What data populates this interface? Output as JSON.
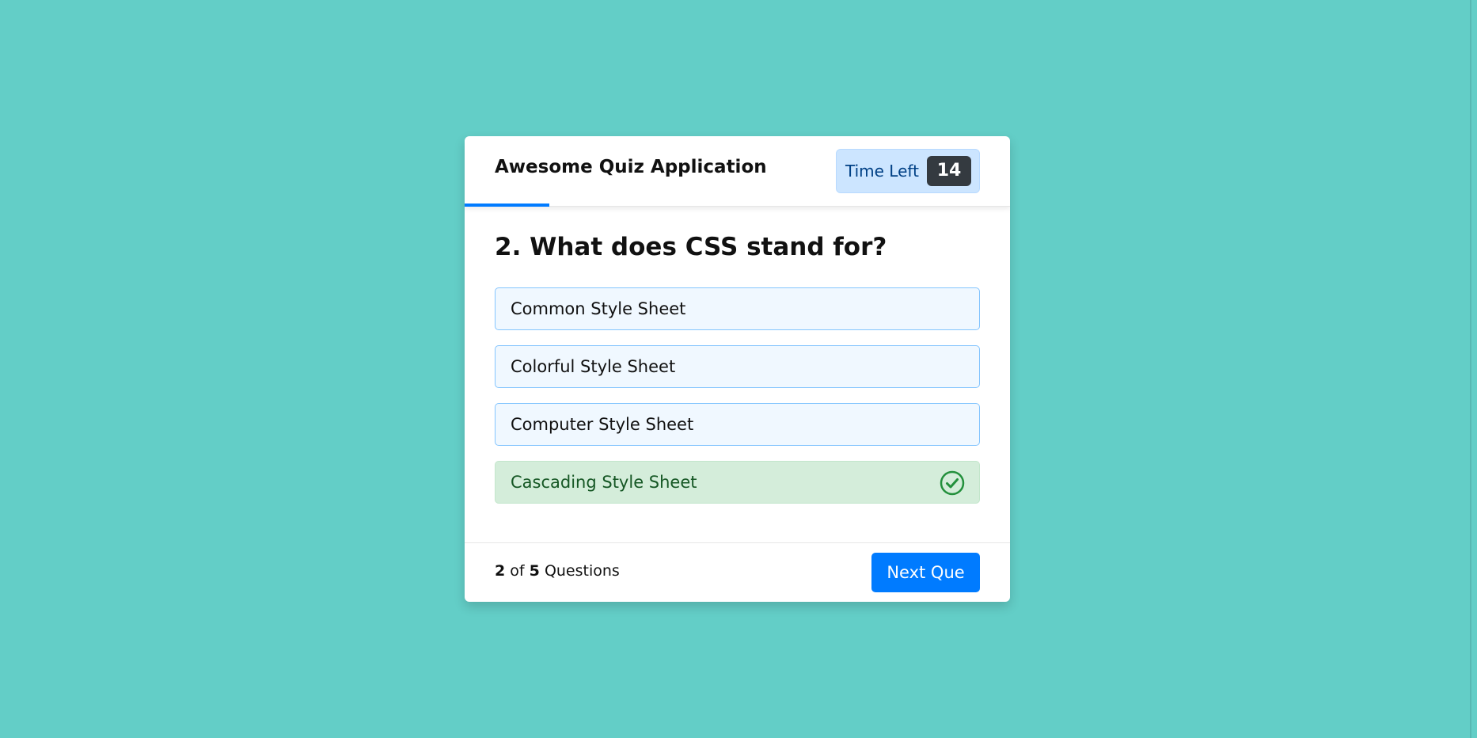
{
  "header": {
    "title": "Awesome Quiz Application",
    "timer_label": "Time Left",
    "timer_value": "14"
  },
  "quiz": {
    "question": "2. What does CSS stand for?",
    "options": [
      {
        "label": "Common Style Sheet",
        "state": "default"
      },
      {
        "label": "Colorful Style Sheet",
        "state": "default"
      },
      {
        "label": "Computer Style Sheet",
        "state": "default"
      },
      {
        "label": "Cascading Style Sheet",
        "state": "correct"
      }
    ],
    "correct_icon": "check-circle-icon"
  },
  "footer": {
    "current": "2",
    "of_text": "of",
    "total": "5",
    "questions_text": "Questions",
    "next_label": "Next Que"
  },
  "colors": {
    "background": "#63cec7",
    "accent": "#007bff",
    "correct": "#155724",
    "correct_bg": "#d4edda",
    "timer_bg": "#cce5ff"
  }
}
